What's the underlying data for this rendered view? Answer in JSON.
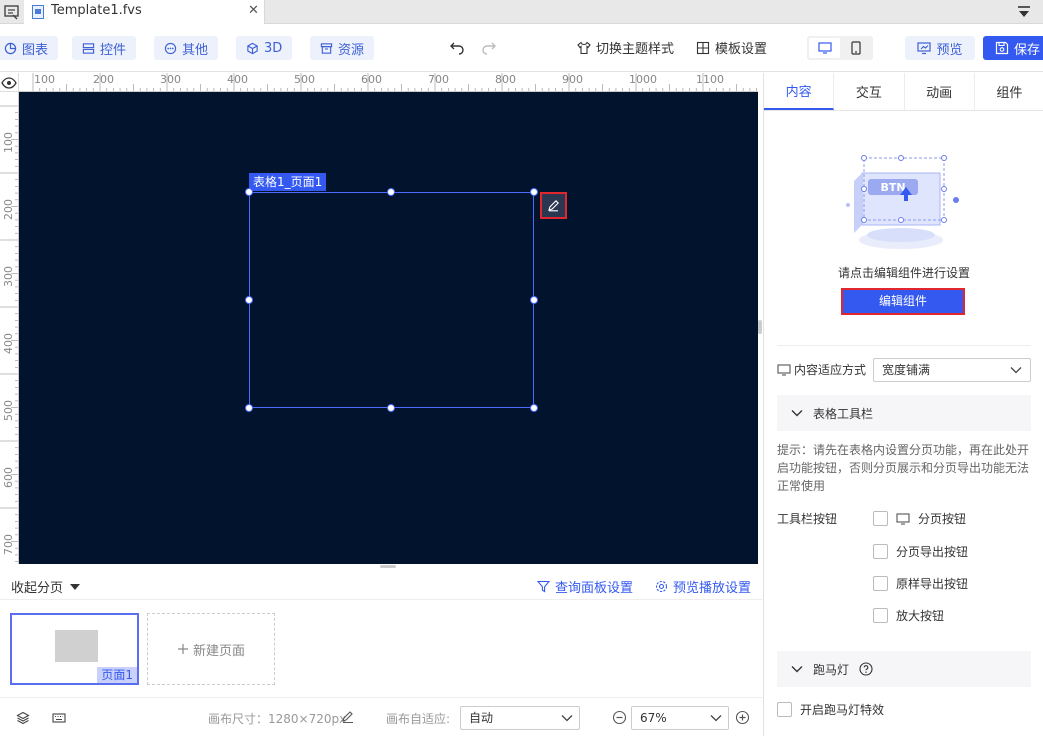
{
  "tab": {
    "title": "Template1.fvs",
    "close": "✕"
  },
  "toolbar": {
    "chart": "图表",
    "widget": "控件",
    "other": "其他",
    "three_d": "3D",
    "resource": "资源",
    "switch_theme": "切换主题样式",
    "template_settings": "模板设置",
    "preview": "预览",
    "save": "保存"
  },
  "ruler": {
    "top": [
      "100",
      "200",
      "300",
      "400",
      "500",
      "600",
      "700",
      "800",
      "900",
      "1000",
      "1100"
    ],
    "left": [
      "100",
      "200",
      "300",
      "400",
      "500",
      "600",
      "700"
    ]
  },
  "canvas": {
    "selection_label": "表格1_页面1",
    "background": "#02132d",
    "accent": "#3459f0"
  },
  "pages": {
    "collapse_label": "收起分页",
    "query_panel": "查询面板设置",
    "preview_play": "预览播放设置",
    "page_name": "页面1",
    "new_page": "新建页面"
  },
  "status": {
    "canvas_size": "画布尺寸：1280×720px",
    "canvas_fit_label": "画布自适应:",
    "canvas_fit_value": "自动",
    "zoom_value": "67%"
  },
  "panel": {
    "tabs": [
      "内容",
      "交互",
      "动画",
      "组件"
    ],
    "illustration_text": "BTN",
    "hint": "请点击编辑组件进行设置",
    "edit_button": "编辑组件",
    "fit_mode_label": "内容适应方式",
    "fit_mode_value": "宽度铺满",
    "toolbar_section": "表格工具栏",
    "tip": "提示：请先在表格内设置分页功能，再在此处开启功能按钮，否则分页展示和分页导出功能无法正常使用",
    "toolbar_buttons_label": "工具栏按钮",
    "checkbox_items": [
      "分页按钮",
      "分页导出按钮",
      "原样导出按钮",
      "放大按钮"
    ],
    "marquee_section": "跑马灯",
    "marquee_toggle": "开启跑马灯特效"
  }
}
